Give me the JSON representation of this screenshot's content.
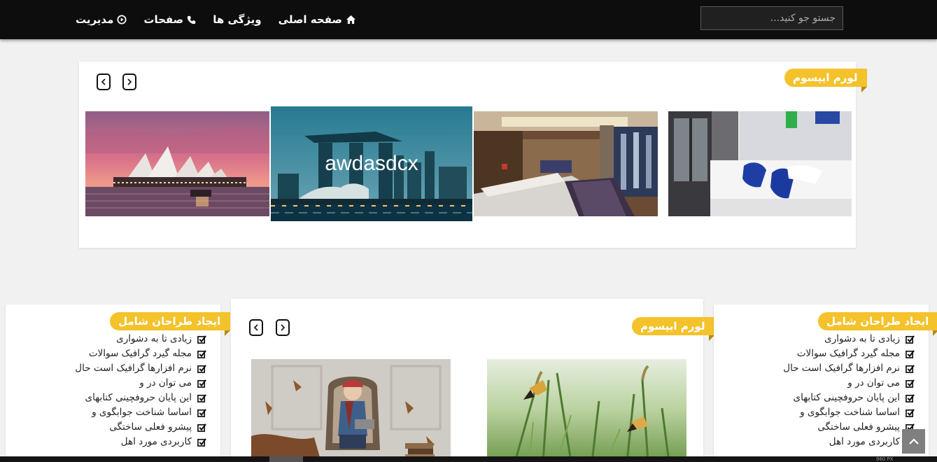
{
  "nav": {
    "items": [
      {
        "label": "صفحه اصلی",
        "icon": "home-icon"
      },
      {
        "label": "ویژگی ها",
        "icon": ""
      },
      {
        "label": "صفحات",
        "icon": "phone-icon"
      },
      {
        "label": "مدیریت",
        "icon": "play-circle-icon"
      }
    ],
    "search_placeholder": "جستو جو کنید..."
  },
  "top_slider": {
    "title": "لورم ایپسوم",
    "slides": [
      {
        "name": "hotel-bedroom",
        "caption": ""
      },
      {
        "name": "hotel-suite",
        "caption": ""
      },
      {
        "name": "marina-bay-sands",
        "caption": "awdasdcx"
      },
      {
        "name": "sydney-opera-house",
        "caption": ""
      }
    ]
  },
  "side_list": {
    "title": "ایجاد طراحان شامل",
    "items": [
      "زیادی تا به دشواری",
      "مجله گیرد گرافیک سوالات",
      "نرم افزارها گرافیک است حال",
      "می توان در و",
      "این پایان حروفچینی کتابهای",
      "اساسا شناخت جوابگوی و",
      "پیشرو فعلی ساختگی",
      "کاربردی مورد اهل"
    ]
  },
  "center_slider": {
    "title": "لورم ایپسوم",
    "slides": [
      {
        "name": "butterflies-grass"
      },
      {
        "name": "boy-in-armchair"
      }
    ]
  },
  "bottom_bar": {
    "text": "960 PX"
  },
  "colors": {
    "accent": "#f4c22b",
    "navbar": "#0d0d0d",
    "background": "#f1f1f1"
  }
}
